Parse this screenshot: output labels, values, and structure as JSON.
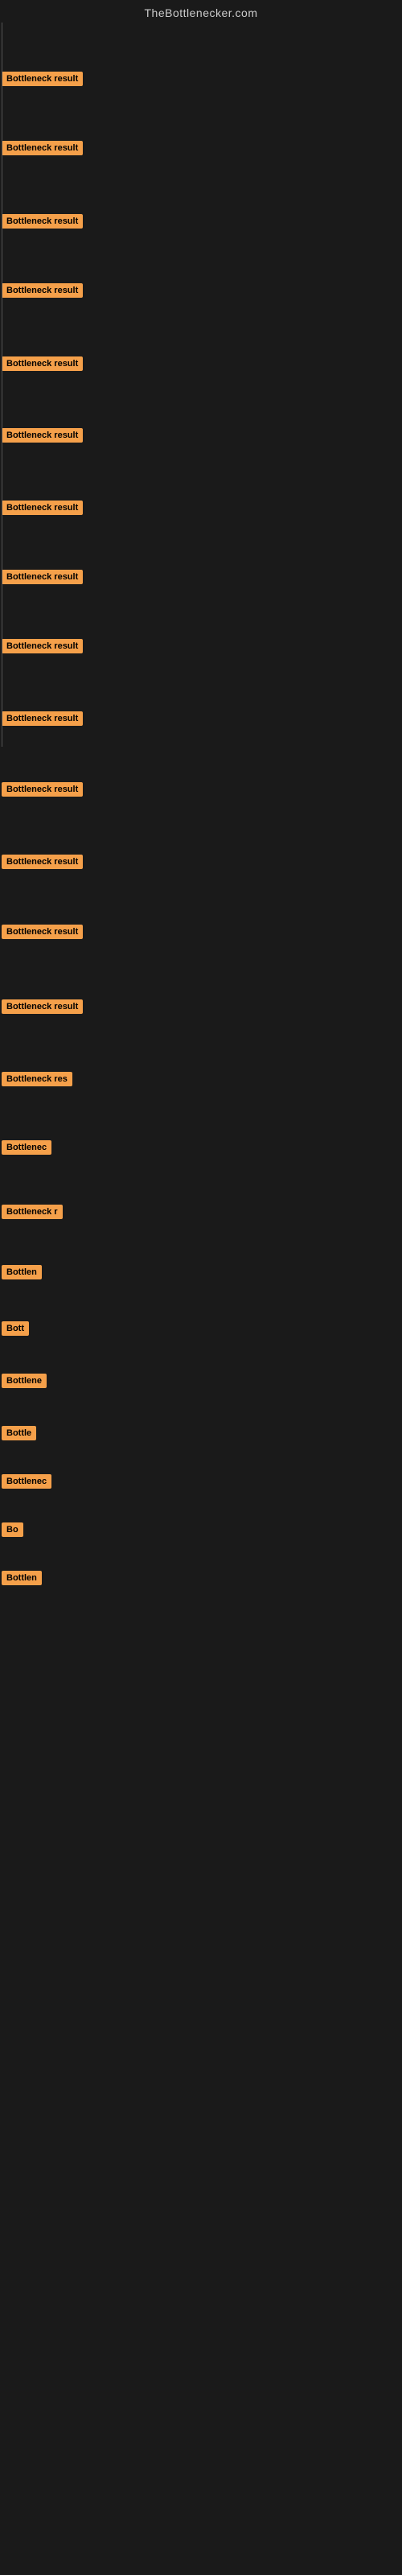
{
  "site": {
    "title": "TheBottlenecker.com"
  },
  "items": [
    {
      "label": "Bottleneck result",
      "width": 120
    },
    {
      "label": "Bottleneck result",
      "width": 120
    },
    {
      "label": "Bottleneck result",
      "width": 120
    },
    {
      "label": "Bottleneck result",
      "width": 120
    },
    {
      "label": "Bottleneck result",
      "width": 120
    },
    {
      "label": "Bottleneck result",
      "width": 120
    },
    {
      "label": "Bottleneck result",
      "width": 120
    },
    {
      "label": "Bottleneck result",
      "width": 120
    },
    {
      "label": "Bottleneck result",
      "width": 120
    },
    {
      "label": "Bottleneck result",
      "width": 120
    },
    {
      "label": "Bottleneck result",
      "width": 120
    },
    {
      "label": "Bottleneck result",
      "width": 120
    },
    {
      "label": "Bottleneck result",
      "width": 120
    },
    {
      "label": "Bottleneck result",
      "width": 120
    },
    {
      "label": "Bottleneck res",
      "width": 100
    },
    {
      "label": "Bottlenec",
      "width": 72
    },
    {
      "label": "Bottleneck r",
      "width": 82
    },
    {
      "label": "Bottlen",
      "width": 58
    },
    {
      "label": "Bott",
      "width": 38
    },
    {
      "label": "Bottlene",
      "width": 62
    },
    {
      "label": "Bottle",
      "width": 50
    },
    {
      "label": "Bottlenec",
      "width": 72
    },
    {
      "label": "Bo",
      "width": 24
    },
    {
      "label": "Bottlen",
      "width": 58
    }
  ],
  "colors": {
    "badge_bg": "#f5a04a",
    "badge_text": "#000000",
    "bg": "#1a1a1a",
    "title": "#cccccc",
    "line": "#555555"
  }
}
